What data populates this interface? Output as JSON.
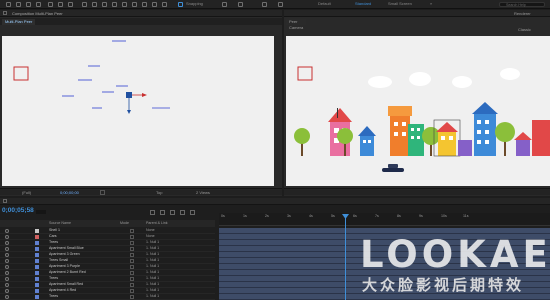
{
  "toolbar": {
    "snapping_label": "Snapping",
    "workspaces": [
      "Default",
      "Standard",
      "Small Screen"
    ],
    "active_workspace": "Standard",
    "search_placeholder": "Search Help"
  },
  "left_viewer": {
    "panel_title": "Composition Multi-Plan Peer",
    "tab_label": "Multi-Plan Peer",
    "zoom_label": "(Full)",
    "timecode": "0;00;00;00",
    "view_label": "Top",
    "views_label": "2 Views"
  },
  "right_viewer": {
    "tab_label": "Peer Camera",
    "right_label_1": "Renderer",
    "right_label_2": "Classic"
  },
  "timeline": {
    "timecode": "0;00;05;58",
    "columns": {
      "source": "Source Name",
      "mode": "Mode",
      "parent": "Parent & Link"
    },
    "ruler": [
      "0s",
      "1s",
      "2s",
      "3s",
      "4s",
      "5s",
      "6s",
      "7s",
      "8s",
      "9s",
      "10s",
      "11s"
    ],
    "layers": [
      {
        "name": "Shell 1",
        "parent": "None"
      },
      {
        "name": "Cars",
        "parent": "None"
      },
      {
        "name": "Trees",
        "parent": "1. Null 1"
      },
      {
        "name": "Apartment Small Blue",
        "parent": "1. Null 1"
      },
      {
        "name": "Apartment 3 Green",
        "parent": "1. Null 1"
      },
      {
        "name": "Trees Small",
        "parent": "1. Null 1"
      },
      {
        "name": "Apartment 3 Purple",
        "parent": "1. Null 1"
      },
      {
        "name": "Apartment 2 Burnt Red",
        "parent": "1. Null 1"
      },
      {
        "name": "Trees",
        "parent": "1. Null 1"
      },
      {
        "name": "Apartment Small Red",
        "parent": "1. Null 1"
      },
      {
        "name": "Apartment 4 Red",
        "parent": "1. Null 1"
      },
      {
        "name": "Trees",
        "parent": "1. Null 1"
      }
    ]
  },
  "watermark": {
    "title": "LOOKAE",
    "subtitle": "大众脸影视后期特效"
  },
  "colors": {
    "accent": "#3f8fd8",
    "track": "#3e4c68",
    "canvas": "#f0f0f0"
  }
}
